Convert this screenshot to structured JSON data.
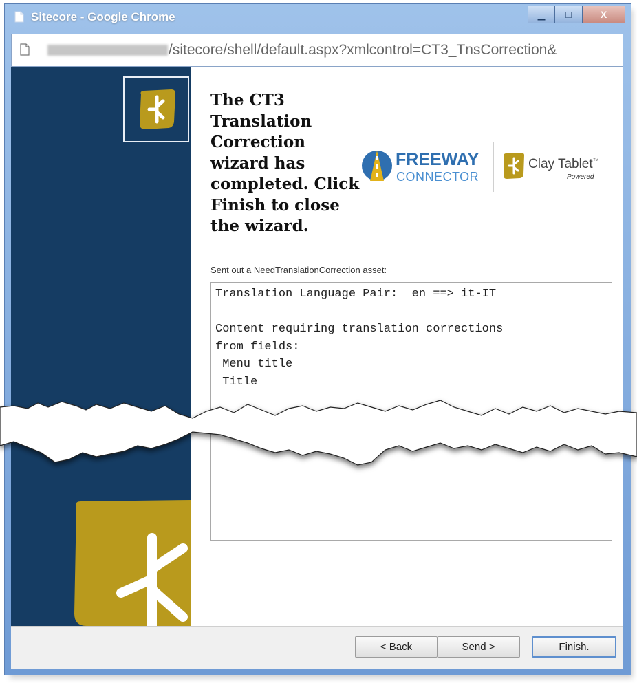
{
  "window": {
    "title": "Sitecore - Google Chrome",
    "controls": {
      "minimize": "▁",
      "maximize": "□",
      "close": "X"
    }
  },
  "address_bar": {
    "url_visible": "/sitecore/shell/default.aspx?xmlcontrol=CT3_TnsCorrection&"
  },
  "wizard": {
    "completion_message": "The CT3 Translation Correction wizard has completed. Click Finish to close the wizard.",
    "asset_label": "Sent out a NeedTranslationCorrection asset:",
    "asset_text": "Translation Language Pair:  en ==> it-IT\n\nContent requiring translation corrections\nfrom fields:\n Menu title\n Title"
  },
  "branding": {
    "freeway_line1": "FREEWAY",
    "freeway_line2": "CONNECTOR",
    "clay_name": "Clay Tablet",
    "clay_tm": "™",
    "clay_powered": "Powered",
    "accent_gold": "#b99a1d",
    "accent_navy": "#153c63"
  },
  "buttons": {
    "back": "< Back",
    "send": "Send >",
    "finish": "Finish."
  },
  "icons": [
    "page-icon",
    "document-icon",
    "clay-tablet-logo-icon",
    "freeway-road-icon"
  ]
}
